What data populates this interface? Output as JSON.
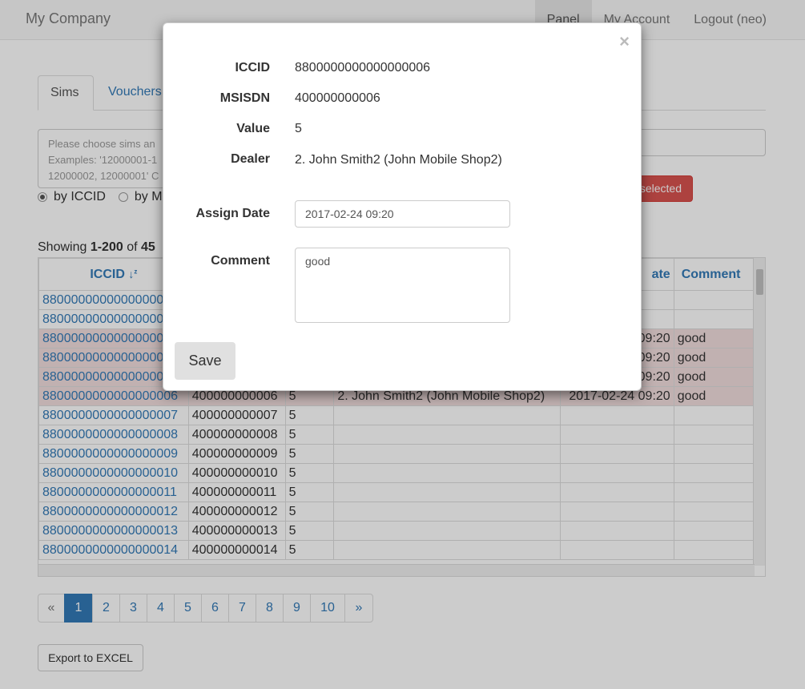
{
  "navbar": {
    "brand": "My Company",
    "items": [
      "Panel",
      "My Account",
      "Logout (neo)"
    ]
  },
  "tabs": [
    "Sims",
    "Vouchers"
  ],
  "filter": {
    "placeholder": "Please choose sims an\nExamples: '12000001-1\n12000002, 12000001' C",
    "radio_iccid": "by ICCID",
    "radio_msisdn": "by M",
    "delete_label": "selected"
  },
  "showing": {
    "prefix": "Showing ",
    "range": "1-200",
    "of": " of ",
    "total": "45"
  },
  "table": {
    "columns": [
      "ICCID",
      "",
      "",
      "",
      "ate",
      "Comment"
    ],
    "sort_icon": "sort-desc-icon",
    "rows": [
      {
        "iccid": "880000000000000000",
        "msisdn": "",
        "value": "",
        "dealer": "",
        "date": "",
        "comment": "",
        "hl": false
      },
      {
        "iccid": "880000000000000000",
        "msisdn": "",
        "value": "",
        "dealer": "",
        "date": "",
        "comment": "",
        "hl": false
      },
      {
        "iccid": "880000000000000000",
        "msisdn": "",
        "value": "",
        "dealer": "",
        "date": "09:20",
        "comment": "good",
        "hl": true
      },
      {
        "iccid": "880000000000000000",
        "msisdn": "",
        "value": "",
        "dealer": "",
        "date": "09:20",
        "comment": "good",
        "hl": true
      },
      {
        "iccid": "880000000000000000",
        "msisdn": "",
        "value": "",
        "dealer": "",
        "date": "09:20",
        "comment": "good",
        "hl": true
      },
      {
        "iccid": "8800000000000000006",
        "msisdn": "400000000006",
        "value": "5",
        "dealer": "2. John Smith2 (John Mobile Shop2)",
        "date": "2017-02-24 09:20",
        "comment": "good",
        "hl": true
      },
      {
        "iccid": "8800000000000000007",
        "msisdn": "400000000007",
        "value": "5",
        "dealer": "",
        "date": "",
        "comment": "",
        "hl": false
      },
      {
        "iccid": "8800000000000000008",
        "msisdn": "400000000008",
        "value": "5",
        "dealer": "",
        "date": "",
        "comment": "",
        "hl": false
      },
      {
        "iccid": "8800000000000000009",
        "msisdn": "400000000009",
        "value": "5",
        "dealer": "",
        "date": "",
        "comment": "",
        "hl": false
      },
      {
        "iccid": "8800000000000000010",
        "msisdn": "400000000010",
        "value": "5",
        "dealer": "",
        "date": "",
        "comment": "",
        "hl": false
      },
      {
        "iccid": "8800000000000000011",
        "msisdn": "400000000011",
        "value": "5",
        "dealer": "",
        "date": "",
        "comment": "",
        "hl": false
      },
      {
        "iccid": "8800000000000000012",
        "msisdn": "400000000012",
        "value": "5",
        "dealer": "",
        "date": "",
        "comment": "",
        "hl": false
      },
      {
        "iccid": "8800000000000000013",
        "msisdn": "400000000013",
        "value": "5",
        "dealer": "",
        "date": "",
        "comment": "",
        "hl": false
      },
      {
        "iccid": "8800000000000000014",
        "msisdn": "400000000014",
        "value": "5",
        "dealer": "",
        "date": "",
        "comment": "",
        "hl": false
      }
    ]
  },
  "pagination": [
    "«",
    "1",
    "2",
    "3",
    "4",
    "5",
    "6",
    "7",
    "8",
    "9",
    "10",
    "»"
  ],
  "active_page": "1",
  "export_label": "Export to EXCEL",
  "modal": {
    "close": "×",
    "iccid_label": "ICCID",
    "iccid_value": "8800000000000000006",
    "msisdn_label": "MSISDN",
    "msisdn_value": "400000000006",
    "value_label": "Value",
    "value_value": "5",
    "dealer_label": "Dealer",
    "dealer_value": "2. John Smith2 (John Mobile Shop2)",
    "assign_label": "Assign Date",
    "assign_value": "2017-02-24 09:20",
    "comment_label": "Comment",
    "comment_value": "good",
    "save_label": "Save"
  },
  "colors": {
    "link": "#337ab7",
    "highlight": "#f2dede",
    "danger": "#d9534f"
  }
}
